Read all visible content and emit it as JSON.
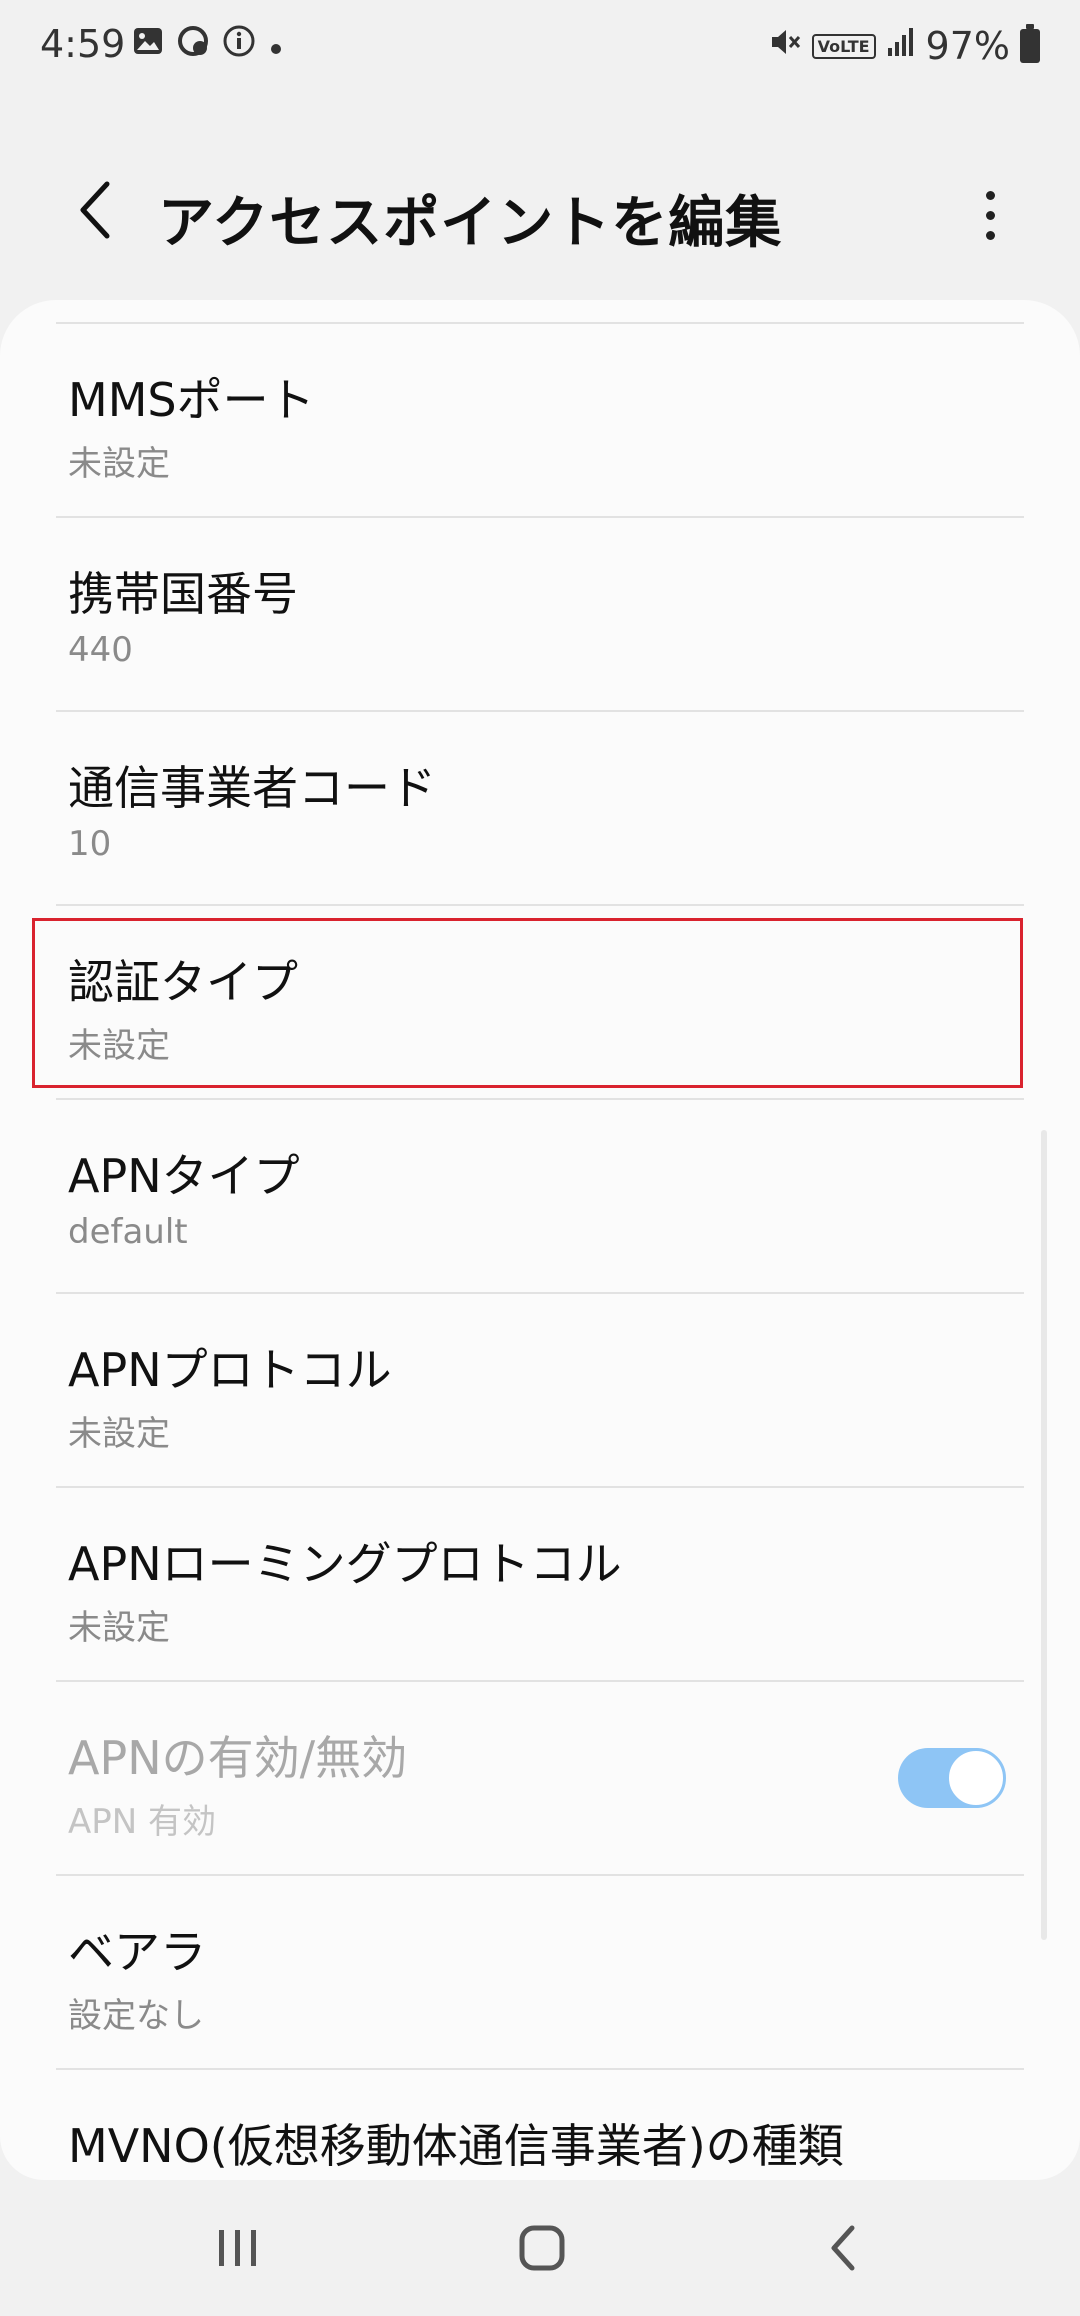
{
  "status_bar": {
    "time": "4:59",
    "left_icons": [
      "gallery-icon",
      "sync-icon",
      "info-icon",
      "dot-icon"
    ],
    "volte": "VoLTE",
    "battery": "97%"
  },
  "app_bar": {
    "title": "アクセスポイントを編集"
  },
  "settings": [
    {
      "title": "MMSポート",
      "summary": "未設定"
    },
    {
      "title": "携帯国番号",
      "summary": "440"
    },
    {
      "title": "通信事業者コード",
      "summary": "10"
    },
    {
      "title": "認証タイプ",
      "summary": "未設定"
    },
    {
      "title": "APNタイプ",
      "summary": "default"
    },
    {
      "title": "APNプロトコル",
      "summary": "未設定"
    },
    {
      "title": "APNローミングプロトコル",
      "summary": "未設定"
    },
    {
      "title": "APNの有効/無効",
      "summary": "APN 有効",
      "toggle_on": true,
      "disabled": true
    },
    {
      "title": "ベアラ",
      "summary": "設定なし"
    },
    {
      "title": "MVNO(仮想移動体通信事業者)の種類",
      "summary": ""
    }
  ],
  "colors": {
    "highlight": "#d9232e",
    "toggle_on": "#8ec5f5"
  }
}
